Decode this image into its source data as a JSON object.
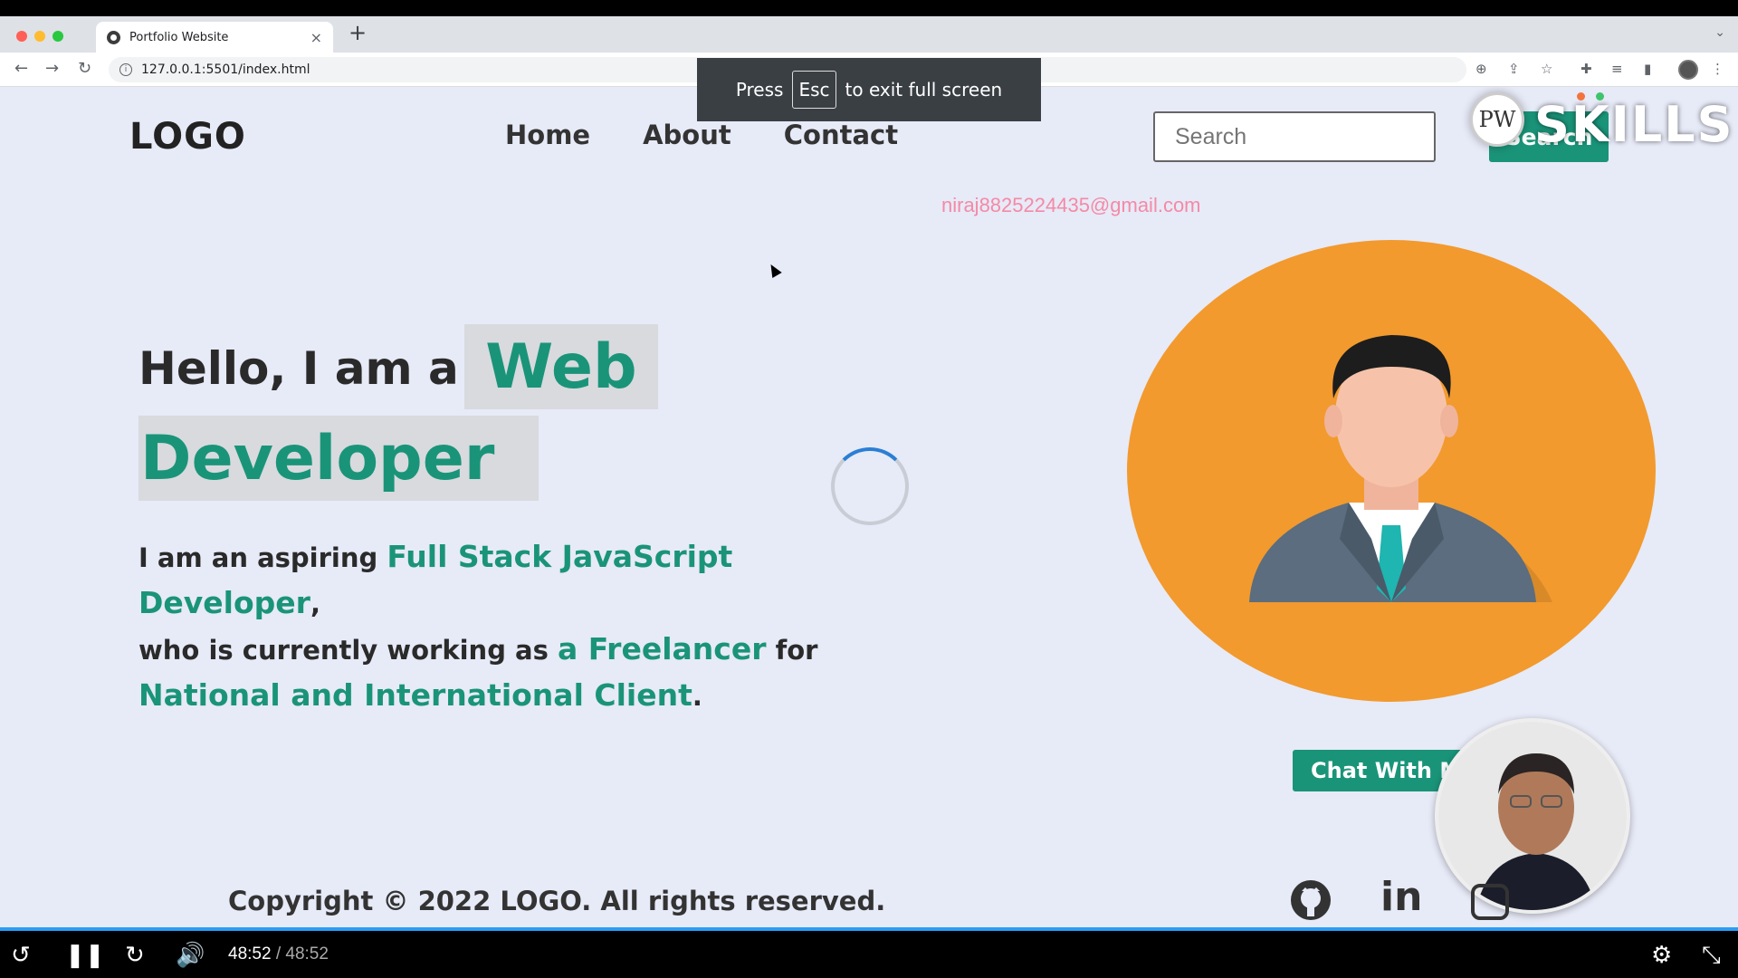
{
  "browser": {
    "tab_title": "Portfolio Website",
    "tab_close": "×",
    "new_tab": "+",
    "url": "127.0.0.1:5501/index.html",
    "fullscreen_banner": {
      "prefix": "Press",
      "key": "Esc",
      "suffix": "to exit full screen"
    }
  },
  "site": {
    "logo": "LOGO",
    "nav": [
      "Home",
      "About",
      "Contact"
    ],
    "search_placeholder": "Search",
    "search_button": "Search",
    "email": "niraj8825224435@gmail.com",
    "hero": {
      "hello": "Hello, I am a",
      "highlight_1": "Web",
      "highlight_2": "Developer",
      "desc_1": "I am an aspiring ",
      "desc_hl_1": "Full Stack JavaScript Developer",
      "desc_2": ",",
      "desc_3": "who is currently working as ",
      "desc_hl_2": "a Freelancer",
      "desc_4": " for",
      "desc_hl_3": "National and International Client",
      "desc_5": "."
    },
    "chat_button": "Chat With Me",
    "copyright": "Copyright © 2022 LOGO. All rights reserved.",
    "social_icons": [
      "github-icon",
      "linkedin-icon",
      "instagram-icon"
    ]
  },
  "watermark": {
    "pw": "PW",
    "skills": "SKILLS"
  },
  "video": {
    "current_time": "48:52",
    "duration": "/ 48:52",
    "progress": 1.0
  },
  "colors": {
    "accent": "#1a9479",
    "avatar_bg": "#f29a2e",
    "email": "#f48aa6"
  }
}
